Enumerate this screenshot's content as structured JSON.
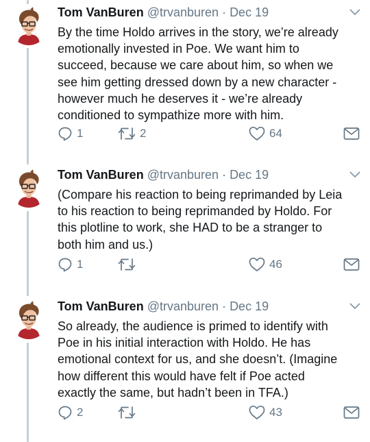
{
  "tweets": [
    {
      "name": "Tom VanBuren",
      "handle": "@trvanburen",
      "separator": "·",
      "date": "Dec 19",
      "lines": [
        "By the time Holdo arrives in the story, we’re already",
        "emotionally invested in Poe. We want him to",
        "succeed, because we care about him, so when we",
        "see him getting dressed down by a new character -",
        "however much he deserves it - we’re already",
        "conditioned to sympathize more with him."
      ],
      "replies": "1",
      "retweets": "2",
      "likes": "64"
    },
    {
      "name": "Tom VanBuren",
      "handle": "@trvanburen",
      "separator": "·",
      "date": "Dec 19",
      "lines": [
        "(Compare his reaction to being reprimanded by Leia",
        "to his reaction to being reprimanded by Holdo. For",
        "this plotline to work, she HAD to be a stranger to",
        "both him and us.)"
      ],
      "replies": "1",
      "retweets": "",
      "likes": "46"
    },
    {
      "name": "Tom VanBuren",
      "handle": "@trvanburen",
      "separator": "·",
      "date": "Dec 19",
      "lines": [
        "So already, the audience is primed to identify with",
        "Poe in his initial interaction with Holdo. He has",
        "emotional context for us, and she doesn’t. (Imagine",
        "how different this would have felt if Poe acted",
        "exactly the same, but hadn’t been in TFA.)"
      ],
      "replies": "2",
      "retweets": "",
      "likes": "43"
    }
  ],
  "icons": {
    "reply": "reply-icon",
    "retweet": "retweet-icon",
    "like": "heart-icon",
    "dm": "mail-icon",
    "menu": "chevron-down-icon"
  },
  "colors": {
    "text": "#14171a",
    "secondary": "#657786",
    "thread_line": "#c4cfd6"
  }
}
